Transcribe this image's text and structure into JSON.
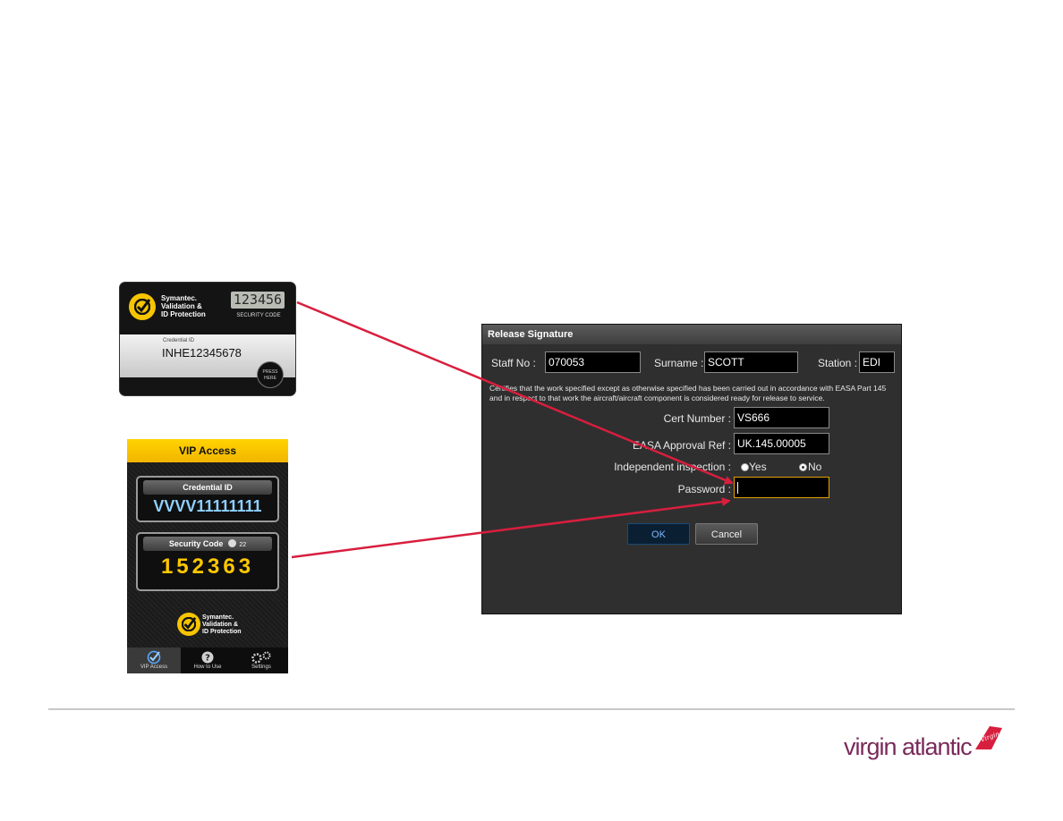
{
  "hardware_token": {
    "brand_line1": "Symantec.",
    "brand_line2": "Validation &",
    "brand_line3": "ID Protection",
    "security_code_display": "123456",
    "security_code_label": "SECURITY CODE",
    "credential_label": "Credential ID",
    "credential_id": "INHE12345678",
    "press_button_line1": "PRESS",
    "press_button_line2": "HERE"
  },
  "vip_app": {
    "title": "VIP Access",
    "credential_label": "Credential ID",
    "credential_id": "VVVV11111111",
    "security_code_label": "Security Code",
    "timer_seconds": "22",
    "security_code": "152363",
    "brand_line1": "Symantec.",
    "brand_line2": "Validation &",
    "brand_line3": "ID Protection",
    "tabs": [
      {
        "label": "VIP Access",
        "icon": "checkmark-icon",
        "active": true
      },
      {
        "label": "How to Use",
        "icon": "help-icon",
        "active": false
      },
      {
        "label": "Settings",
        "icon": "gears-icon",
        "active": false
      }
    ]
  },
  "dialog": {
    "title": "Release Signature",
    "staff_no_label": "Staff No :",
    "staff_no_value": "070053",
    "surname_label": "Surname :",
    "surname_value": "SCOTT",
    "station_label": "Station :",
    "station_value": "EDI",
    "certifies_text": "Certifies that the work specified except as otherwise specified has been carried out in accordance with EASA Part 145 and in respect to that work the aircraft/aircraft component is considered ready for release to service.",
    "cert_number_label": "Cert Number :",
    "cert_number_value": "VS666",
    "easa_ref_label": "EASA Approval Ref :",
    "easa_ref_value": "UK.145.00005",
    "independent_inspection_label": "Independent inspection :",
    "yes_label": "Yes",
    "no_label": "No",
    "selected_option": "No",
    "password_label": "Password :",
    "password_value": "",
    "ok_label": "OK",
    "cancel_label": "Cancel"
  },
  "footer": {
    "brand_text": "virgin atlantic",
    "tail_logo_text": "Virgin"
  },
  "colors": {
    "arrow": "#d81e3e",
    "token_yellow": "#f6c500",
    "vip_bar": "#ffd400",
    "code_yellow": "#ffc800",
    "cred_blue": "#8fd0ff",
    "virgin_purple": "#7a2a5a",
    "focus_border": "#e0a000"
  }
}
